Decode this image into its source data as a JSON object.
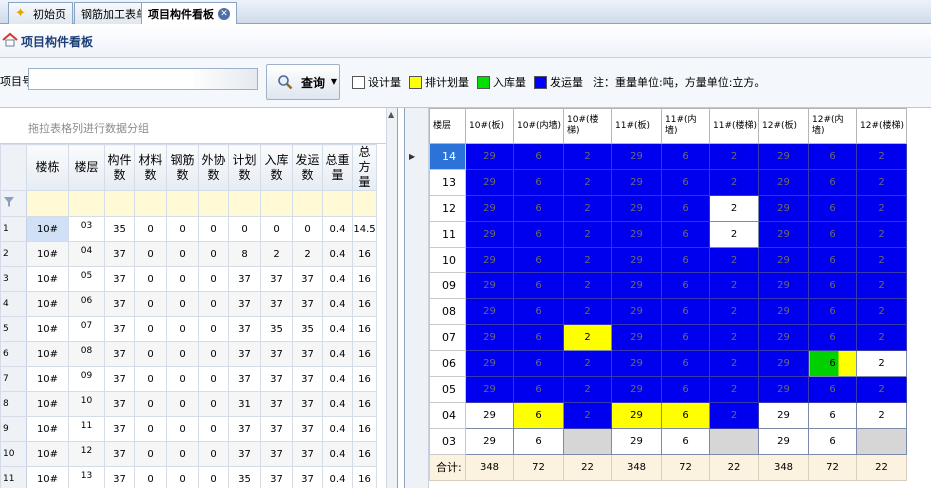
{
  "tabs": [
    {
      "label": "初始页",
      "active": false
    },
    {
      "label": "钢筋加工表单",
      "active": false
    },
    {
      "label": "项目构件看板",
      "active": true
    }
  ],
  "page": {
    "title": "项目构件看板"
  },
  "toolbar": {
    "project_label": "项目号:",
    "project_value": "",
    "query_label": "查询",
    "legend": [
      {
        "label": "设计量",
        "color": "#ffffff"
      },
      {
        "label": "排计划量",
        "color": "#ffff00"
      },
      {
        "label": "入库量",
        "color": "#00e000"
      },
      {
        "label": "发运量",
        "color": "#0000ff"
      }
    ],
    "note": "注：重量单位:吨，方量单位:立方。"
  },
  "left_grid": {
    "group_hint": "拖拉表格列进行数据分组",
    "columns": [
      {
        "label": "楼栋",
        "w": 42
      },
      {
        "label": "楼层",
        "w": 36
      },
      {
        "label": "构件数",
        "w": 30
      },
      {
        "label": "材料数",
        "w": 32
      },
      {
        "label": "钢筋数",
        "w": 32
      },
      {
        "label": "外协数",
        "w": 30
      },
      {
        "label": "计划数",
        "w": 32
      },
      {
        "label": "入库数",
        "w": 32
      },
      {
        "label": "发运数",
        "w": 30
      },
      {
        "label": "总重量",
        "w": 30
      },
      {
        "label": "总方量",
        "w": 24
      }
    ],
    "rows": [
      [
        "1",
        "10#",
        "03",
        "35",
        "0",
        "0",
        "0",
        "0",
        "0",
        "0",
        "0.4",
        "14.5"
      ],
      [
        "2",
        "10#",
        "04",
        "37",
        "0",
        "0",
        "0",
        "8",
        "2",
        "2",
        "0.4",
        "16"
      ],
      [
        "3",
        "10#",
        "05",
        "37",
        "0",
        "0",
        "0",
        "37",
        "37",
        "37",
        "0.4",
        "16"
      ],
      [
        "4",
        "10#",
        "06",
        "37",
        "0",
        "0",
        "0",
        "37",
        "37",
        "37",
        "0.4",
        "16"
      ],
      [
        "5",
        "10#",
        "07",
        "37",
        "0",
        "0",
        "0",
        "37",
        "35",
        "35",
        "0.4",
        "16"
      ],
      [
        "6",
        "10#",
        "08",
        "37",
        "0",
        "0",
        "0",
        "37",
        "37",
        "37",
        "0.4",
        "16"
      ],
      [
        "7",
        "10#",
        "09",
        "37",
        "0",
        "0",
        "0",
        "37",
        "37",
        "37",
        "0.4",
        "16"
      ],
      [
        "8",
        "10#",
        "10",
        "37",
        "0",
        "0",
        "0",
        "31",
        "37",
        "37",
        "0.4",
        "16"
      ],
      [
        "9",
        "10#",
        "11",
        "37",
        "0",
        "0",
        "0",
        "37",
        "37",
        "37",
        "0.4",
        "16"
      ],
      [
        "10",
        "10#",
        "12",
        "37",
        "0",
        "0",
        "0",
        "37",
        "37",
        "37",
        "0.4",
        "16"
      ],
      [
        "11",
        "10#",
        "13",
        "37",
        "0",
        "0",
        "0",
        "35",
        "37",
        "37",
        "0.4",
        "16"
      ]
    ]
  },
  "right_grid": {
    "header": [
      {
        "label": "楼层",
        "w": 36
      },
      {
        "label": "10#(板)",
        "w": 48
      },
      {
        "label": "10#(内墙)",
        "w": 50
      },
      {
        "label": "10#(楼梯)",
        "w": 48
      },
      {
        "label": "11#(板)",
        "w": 50
      },
      {
        "label": "11#(内墙)",
        "w": 48
      },
      {
        "label": "11#(楼梯)",
        "w": 49
      },
      {
        "label": "12#(板)",
        "w": 50
      },
      {
        "label": "12#(内墙)",
        "w": 48
      },
      {
        "label": "12#(楼梯)",
        "w": 50
      }
    ],
    "colors": {
      "W": "#ffffff",
      "Y": "#ffff00",
      "G": "#00d000",
      "B": "#0000ee",
      "S": "#d6d6d6",
      "T": "#fbf2e0"
    },
    "rows": [
      {
        "floor": "14",
        "selected": true,
        "cells": [
          [
            "29",
            "B"
          ],
          [
            "6",
            "B"
          ],
          [
            "2",
            "B"
          ],
          [
            "29",
            "B"
          ],
          [
            "6",
            "B"
          ],
          [
            "2",
            "B"
          ],
          [
            "29",
            "B"
          ],
          [
            "6",
            "B"
          ],
          [
            "2",
            "B"
          ]
        ]
      },
      {
        "floor": "13",
        "cells": [
          [
            "29",
            "B"
          ],
          [
            "6",
            "B"
          ],
          [
            "2",
            "B"
          ],
          [
            "29",
            "B"
          ],
          [
            "6",
            "B"
          ],
          [
            "2",
            "B"
          ],
          [
            "29",
            "B"
          ],
          [
            "6",
            "B"
          ],
          [
            "2",
            "B"
          ]
        ]
      },
      {
        "floor": "12",
        "cells": [
          [
            "29",
            "B"
          ],
          [
            "6",
            "B"
          ],
          [
            "2",
            "B"
          ],
          [
            "29",
            "B"
          ],
          [
            "6",
            "B"
          ],
          [
            "2",
            "W"
          ],
          [
            "29",
            "B"
          ],
          [
            "6",
            "B"
          ],
          [
            "2",
            "B"
          ]
        ]
      },
      {
        "floor": "11",
        "cells": [
          [
            "29",
            "B"
          ],
          [
            "6",
            "B"
          ],
          [
            "2",
            "B"
          ],
          [
            "29",
            "B"
          ],
          [
            "6",
            "B"
          ],
          [
            "2",
            "W"
          ],
          [
            "29",
            "B"
          ],
          [
            "6",
            "B"
          ],
          [
            "2",
            "B"
          ]
        ]
      },
      {
        "floor": "10",
        "cells": [
          [
            "29",
            "B"
          ],
          [
            "6",
            "B"
          ],
          [
            "2",
            "B"
          ],
          [
            "29",
            "B"
          ],
          [
            "6",
            "B"
          ],
          [
            "2",
            "B"
          ],
          [
            "29",
            "B"
          ],
          [
            "6",
            "B"
          ],
          [
            "2",
            "B"
          ]
        ]
      },
      {
        "floor": "09",
        "cells": [
          [
            "29",
            "B"
          ],
          [
            "6",
            "B"
          ],
          [
            "2",
            "B"
          ],
          [
            "29",
            "B"
          ],
          [
            "6",
            "B"
          ],
          [
            "2",
            "B"
          ],
          [
            "29",
            "B"
          ],
          [
            "6",
            "B"
          ],
          [
            "2",
            "B"
          ]
        ]
      },
      {
        "floor": "08",
        "cells": [
          [
            "29",
            "B"
          ],
          [
            "6",
            "B"
          ],
          [
            "2",
            "B"
          ],
          [
            "29",
            "B"
          ],
          [
            "6",
            "B"
          ],
          [
            "2",
            "B"
          ],
          [
            "29",
            "B"
          ],
          [
            "6",
            "B"
          ],
          [
            "2",
            "B"
          ]
        ]
      },
      {
        "floor": "07",
        "cells": [
          [
            "29",
            "B"
          ],
          [
            "6",
            "B"
          ],
          [
            "2",
            "Y"
          ],
          [
            "29",
            "B"
          ],
          [
            "6",
            "B"
          ],
          [
            "2",
            "B"
          ],
          [
            "29",
            "B"
          ],
          [
            "6",
            "B"
          ],
          [
            "2",
            "B"
          ]
        ]
      },
      {
        "floor": "06",
        "cells": [
          [
            "29",
            "B"
          ],
          [
            "6",
            "B"
          ],
          [
            "2",
            "B"
          ],
          [
            "29",
            "B"
          ],
          [
            "6",
            "B"
          ],
          [
            "2",
            "B"
          ],
          [
            "29",
            "B"
          ],
          [
            "6",
            "GY"
          ],
          [
            "2",
            "W"
          ]
        ]
      },
      {
        "floor": "05",
        "cells": [
          [
            "29",
            "B"
          ],
          [
            "6",
            "B"
          ],
          [
            "2",
            "B"
          ],
          [
            "29",
            "B"
          ],
          [
            "6",
            "B"
          ],
          [
            "2",
            "B"
          ],
          [
            "29",
            "B"
          ],
          [
            "6",
            "B"
          ],
          [
            "2",
            "B"
          ]
        ]
      },
      {
        "floor": "04",
        "cells": [
          [
            "29",
            "W"
          ],
          [
            "6",
            "Y"
          ],
          [
            "2",
            "B"
          ],
          [
            "29",
            "Y"
          ],
          [
            "6",
            "Y"
          ],
          [
            "2",
            "B"
          ],
          [
            "29",
            "W"
          ],
          [
            "6",
            "W"
          ],
          [
            "2",
            "W"
          ]
        ]
      },
      {
        "floor": "03",
        "cells": [
          [
            "29",
            "W"
          ],
          [
            "6",
            "W"
          ],
          [
            "",
            "S"
          ],
          [
            "29",
            "W"
          ],
          [
            "6",
            "W"
          ],
          [
            "",
            "S"
          ],
          [
            "29",
            "W"
          ],
          [
            "6",
            "W"
          ],
          [
            "",
            "S"
          ]
        ]
      },
      {
        "floor": "合计:",
        "total": true,
        "cells": [
          [
            "348",
            "T"
          ],
          [
            "72",
            "T"
          ],
          [
            "22",
            "T"
          ],
          [
            "348",
            "T"
          ],
          [
            "72",
            "T"
          ],
          [
            "22",
            "T"
          ],
          [
            "348",
            "T"
          ],
          [
            "72",
            "T"
          ],
          [
            "22",
            "T"
          ]
        ]
      }
    ]
  }
}
